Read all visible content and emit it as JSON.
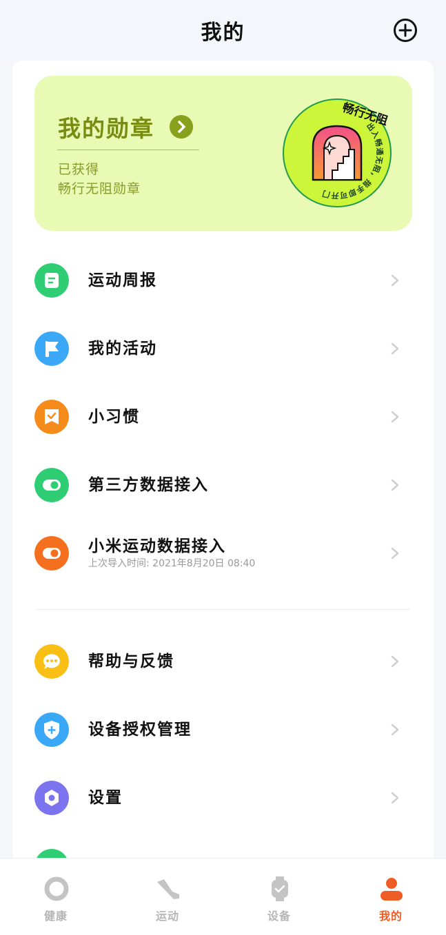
{
  "header": {
    "title": "我的",
    "add_icon": "plus-circle-icon"
  },
  "badge_card": {
    "title": "我的勋章",
    "line1": "已获得",
    "line2": "畅行无阻勋章",
    "medal_name": "畅行无阻",
    "medal_ring_text": "出入畅通无阻，指手即可开门",
    "bg_color": "#e8fab4",
    "accent_color": "#7a8b12"
  },
  "menu": {
    "items": [
      {
        "label": "运动周报",
        "icon": "report-icon",
        "color": "#2fcd74"
      },
      {
        "label": "我的活动",
        "icon": "flag-icon",
        "color": "#3aa8f7"
      },
      {
        "label": "小习惯",
        "icon": "habit-check-icon",
        "color": "#f58b1a"
      },
      {
        "label": "第三方数据接入",
        "icon": "toggle-link-icon",
        "color": "#2fcd74"
      },
      {
        "label": "小米运动数据接入",
        "sub": "上次导入时间: 2021年8月20日 08:40",
        "icon": "toggle-link-icon",
        "color": "#f5701e"
      },
      {
        "label": "帮助与反馈",
        "icon": "chat-bubble-icon",
        "color": "#f9bf14"
      },
      {
        "label": "设备授权管理",
        "icon": "shield-plus-icon",
        "color": "#3aa8f7"
      },
      {
        "label": "设置",
        "icon": "gear-icon",
        "color": "#7b74ee"
      }
    ]
  },
  "tabbar": {
    "tabs": [
      {
        "label": "健康",
        "icon": "ring-icon",
        "active": false
      },
      {
        "label": "运动",
        "icon": "shoe-icon",
        "active": false
      },
      {
        "label": "设备",
        "icon": "watch-icon",
        "active": false
      },
      {
        "label": "我的",
        "icon": "person-icon",
        "active": true
      }
    ],
    "active_color": "#ee5d25",
    "inactive_color": "#b5b5b5"
  }
}
